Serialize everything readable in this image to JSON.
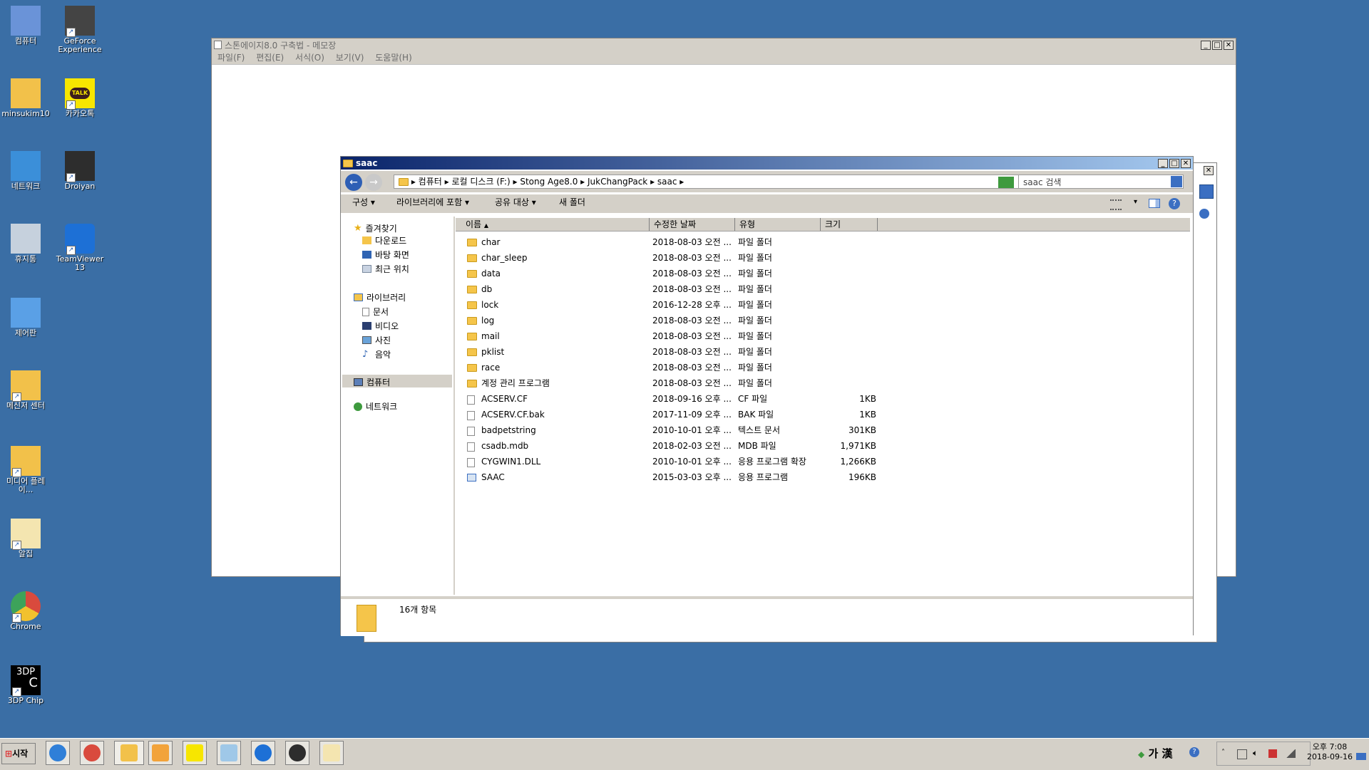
{
  "desktop": {
    "icons": [
      {
        "label": "컴퓨터",
        "icon": "computer-icon"
      },
      {
        "label": "GeForce Experience",
        "icon": "geforce-icon"
      },
      {
        "label": "minsukim10",
        "icon": "user-folder-icon"
      },
      {
        "label": "카카오톡",
        "icon": "kakaotalk-icon"
      },
      {
        "label": "네트워크",
        "icon": "network-icon"
      },
      {
        "label": "Droiyan",
        "icon": "droiyan-icon"
      },
      {
        "label": "휴지통",
        "icon": "recycle-bin-icon"
      },
      {
        "label": "TeamViewer 13",
        "icon": "teamviewer-icon"
      },
      {
        "label": "제어판",
        "icon": "control-panel-icon"
      },
      {
        "label": "메신저 센터",
        "icon": "messenger-center-icon"
      },
      {
        "label": "미디어 플레이...",
        "icon": "media-player-icon"
      },
      {
        "label": "알집",
        "icon": "alzip-icon"
      },
      {
        "label": "Chrome",
        "icon": "chrome-icon"
      },
      {
        "label": "3DP Chip",
        "icon": "3dp-chip-icon"
      }
    ],
    "chip_logo_top": "3DP",
    "chip_logo_bottom": "C",
    "talk_logo": "TALK"
  },
  "notepad": {
    "title": "스톤에이지8.0 구축법 - 메모장",
    "menu": [
      "파일(F)",
      "편집(E)",
      "서식(O)",
      "보기(V)",
      "도움말(H)"
    ]
  },
  "explorer": {
    "title": "saac",
    "breadcrumb": [
      "컴퓨터",
      "로컬 디스크 (F:)",
      "Stong Age8.0",
      "JukChangPack",
      "saac"
    ],
    "search_placeholder": "saac 검색",
    "toolbar": {
      "organize": "구성",
      "include_library": "라이브러리에 포함",
      "share": "공유 대상",
      "new_folder": "새 폴더"
    },
    "nav": {
      "favorites": "즐겨찾기",
      "favorites_items": [
        "다운로드",
        "바탕 화면",
        "최근 위치"
      ],
      "libraries": "라이브러리",
      "library_items": [
        "문서",
        "비디오",
        "사진",
        "음악"
      ],
      "computer": "컴퓨터",
      "network": "네트워크"
    },
    "columns": {
      "name": "이름",
      "modified": "수정한 날짜",
      "type": "유형",
      "size": "크기"
    },
    "files": [
      {
        "name": "char",
        "modified": "2018-08-03 오전 ...",
        "type": "파일 폴더",
        "size": "",
        "kind": "folder"
      },
      {
        "name": "char_sleep",
        "modified": "2018-08-03 오전 ...",
        "type": "파일 폴더",
        "size": "",
        "kind": "folder"
      },
      {
        "name": "data",
        "modified": "2018-08-03 오전 ...",
        "type": "파일 폴더",
        "size": "",
        "kind": "folder"
      },
      {
        "name": "db",
        "modified": "2018-08-03 오전 ...",
        "type": "파일 폴더",
        "size": "",
        "kind": "folder"
      },
      {
        "name": "lock",
        "modified": "2016-12-28 오후 ...",
        "type": "파일 폴더",
        "size": "",
        "kind": "folder"
      },
      {
        "name": "log",
        "modified": "2018-08-03 오전 ...",
        "type": "파일 폴더",
        "size": "",
        "kind": "folder"
      },
      {
        "name": "mail",
        "modified": "2018-08-03 오전 ...",
        "type": "파일 폴더",
        "size": "",
        "kind": "folder"
      },
      {
        "name": "pklist",
        "modified": "2018-08-03 오전 ...",
        "type": "파일 폴더",
        "size": "",
        "kind": "folder"
      },
      {
        "name": "race",
        "modified": "2018-08-03 오전 ...",
        "type": "파일 폴더",
        "size": "",
        "kind": "folder"
      },
      {
        "name": "계정 관리 프로그램",
        "modified": "2018-08-03 오전 ...",
        "type": "파일 폴더",
        "size": "",
        "kind": "folder"
      },
      {
        "name": "ACSERV.CF",
        "modified": "2018-09-16 오후 ...",
        "type": "CF 파일",
        "size": "1KB",
        "kind": "file"
      },
      {
        "name": "ACSERV.CF.bak",
        "modified": "2017-11-09 오후 ...",
        "type": "BAK 파일",
        "size": "1KB",
        "kind": "file"
      },
      {
        "name": "badpetstring",
        "modified": "2010-10-01 오후 ...",
        "type": "텍스트 문서",
        "size": "301KB",
        "kind": "file"
      },
      {
        "name": "csadb.mdb",
        "modified": "2018-02-03 오전 ...",
        "type": "MDB 파일",
        "size": "1,971KB",
        "kind": "file"
      },
      {
        "name": "CYGWIN1.DLL",
        "modified": "2010-10-01 오후 ...",
        "type": "응용 프로그램 확장",
        "size": "1,266KB",
        "kind": "file"
      },
      {
        "name": "SAAC",
        "modified": "2015-03-03 오후 ...",
        "type": "응용 프로그램",
        "size": "196KB",
        "kind": "app"
      }
    ],
    "status": "16개 항목"
  },
  "taskbar": {
    "start_label": "시작",
    "ime": "가 漢",
    "time": "오후 7:08",
    "date": "2018-09-16",
    "pinned": [
      "internet-explorer-icon",
      "chrome-icon",
      "explorer-icon",
      "media-player-icon",
      "kakaotalk-icon",
      "notepad-icon",
      "teamviewer-icon",
      "ultraedit-icon",
      "alzip-icon"
    ]
  }
}
